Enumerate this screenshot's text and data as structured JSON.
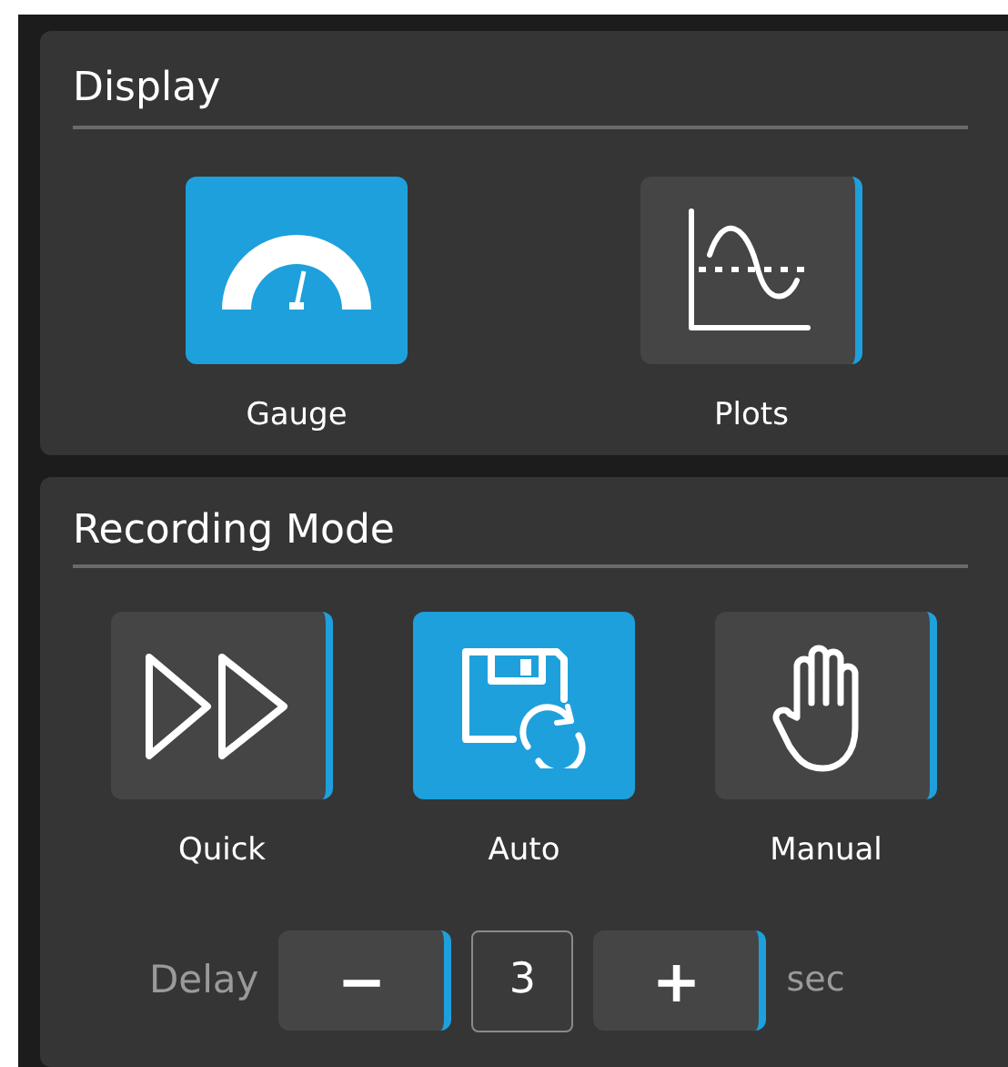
{
  "display": {
    "title": "Display",
    "options": [
      {
        "label": "Gauge",
        "kind": "gauge",
        "selected": true
      },
      {
        "label": "Plots",
        "kind": "plots",
        "selected": false
      }
    ]
  },
  "recording_mode": {
    "title": "Recording Mode",
    "options": [
      {
        "label": "Quick",
        "kind": "quick",
        "selected": false
      },
      {
        "label": "Auto",
        "kind": "auto",
        "selected": true
      },
      {
        "label": "Manual",
        "kind": "manual",
        "selected": false
      }
    ],
    "delay": {
      "label": "Delay",
      "decrement": "−",
      "value": "3",
      "increment": "+",
      "unit": "sec"
    }
  }
}
